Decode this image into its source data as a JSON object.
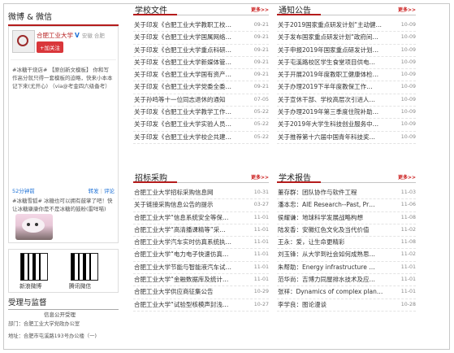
{
  "weibo": {
    "section_title": "微博 & 微信",
    "account_name": "合肥工业大学",
    "verified_mark": "V",
    "location": "安徽 合肥",
    "follow_label": "+加关注",
    "post1": "#冰糖干烧店# 【原创新文模板】 你和写作高分就只得一套模板的迫略，快来小本本记下来(尤开心) （via@考金四六级备考）",
    "post1_date": "52分钟前",
    "repost_label": "转发",
    "comment_label": "评论",
    "post2": "#冰糖雪狐# 冰糖也可以拥有鼓掌了吧！快让冰糖康康你是不是冰糖的鼓粉(雷咩喵)"
  },
  "qr": {
    "weibo_label": "新浪微博",
    "wechat_label": "腾讯微信"
  },
  "supervision": {
    "title": "受理与监督",
    "subtitle": "信息公开受理",
    "dept": "部门：合肥工业大学党政办公室",
    "addr": "地址：合肥市屯溪路193号办公楼（一)"
  },
  "more_label": "更多>>",
  "school_docs": {
    "title": "学校文件",
    "items": [
      {
        "title": "关于印发《合肥工业大学教职工校…",
        "date": "09-21"
      },
      {
        "title": "关于印发《合肥工业大学国属网络…",
        "date": "09-21"
      },
      {
        "title": "关于印发《合肥工业大学重点科研…",
        "date": "09-21"
      },
      {
        "title": "关于印发《合肥工业大学新媒体管…",
        "date": "09-21"
      },
      {
        "title": "关于印发《合肥工业大学国有资产…",
        "date": "09-21"
      },
      {
        "title": "关于印发《合肥工业大学党委全委…",
        "date": "09-21"
      },
      {
        "title": "关于孙鸣等十一位同志退休的通知",
        "date": "07-05"
      },
      {
        "title": "关于印发《合肥工业大学教学工作…",
        "date": "05-22"
      },
      {
        "title": "关于印发《合肥工业大学实验人员…",
        "date": "05-22"
      },
      {
        "title": "关于印发《合肥工业大学校企共建…",
        "date": "05-22"
      }
    ]
  },
  "notices": {
    "title": "通知公告",
    "items": [
      {
        "title": "关于2019国家重点研发计划“主动健…",
        "date": "10-09"
      },
      {
        "title": "关于发布国家重点研发计划“政府间…",
        "date": "10-09"
      },
      {
        "title": "关于申报2019年国家重点研发计划…",
        "date": "10-09"
      },
      {
        "title": "关于屯溪路校区学生食堂项目供电…",
        "date": "10-09"
      },
      {
        "title": "关于开展2019年度教职工健康体检…",
        "date": "10-09"
      },
      {
        "title": "关于办理2019下半年度教保工作…",
        "date": "10-09"
      },
      {
        "title": "关于宣休干部、学校高层次引进人…",
        "date": "10-09"
      },
      {
        "title": "关于办理2019年第三季度住院补助…",
        "date": "10-09"
      },
      {
        "title": "关于2019年大学生科技创业服务中…",
        "date": "10-09"
      },
      {
        "title": "关于推荐第十六届中国青年科技奖…",
        "date": "10-09"
      }
    ]
  },
  "procurement": {
    "title": "招标采购",
    "items": [
      {
        "title": "合肥工业大学招标采购信息网",
        "date": "10-31"
      },
      {
        "title": "关于链接采购信息公告的提示",
        "date": "03-27"
      },
      {
        "title": "合肥工业大学“信息系统安全等保…",
        "date": "11-01"
      },
      {
        "title": "合肥工业大学“高清播课精等”采…",
        "date": "11-01"
      },
      {
        "title": "合肥工业大学汽车实时仿真系统执…",
        "date": "11-01"
      },
      {
        "title": "合肥工业大学“电力电子快速仿真…",
        "date": "11-01"
      },
      {
        "title": "合肥工业大学节能与智能液汽车试…",
        "date": "11-01"
      },
      {
        "title": "合肥工业大学“金融数据库及统计…",
        "date": "11-01"
      },
      {
        "title": "合肥工业大学供应商征集公告",
        "date": "10-29"
      },
      {
        "title": "合肥工业大学“试验型核模声封浅…",
        "date": "10-27"
      }
    ]
  },
  "reports": {
    "title": "学术报告",
    "items": [
      {
        "title": "董存群：团队协作与软件工程",
        "date": "11-03"
      },
      {
        "title": "潘本忠：AIE Research--Past, Pr…",
        "date": "11-06"
      },
      {
        "title": "侯耀谦：地球科学发展战略构想",
        "date": "11-08"
      },
      {
        "title": "陆发香：安徽红色文化及当代价值",
        "date": "11-02"
      },
      {
        "title": "王永：爱，让生命更精彩",
        "date": "11-08"
      },
      {
        "title": "刘玉锋：从大学到社会如何成熟思…",
        "date": "11-02"
      },
      {
        "title": "朱帮助：Energy infrastructure …",
        "date": "11-01"
      },
      {
        "title": "范华尚：吉博力同屋排水技术及应…",
        "date": "11-01"
      },
      {
        "title": "张祥：Dynamics of complex plan…",
        "date": "11-01"
      },
      {
        "title": "李学良：图论漫谈",
        "date": "10-28"
      }
    ]
  }
}
